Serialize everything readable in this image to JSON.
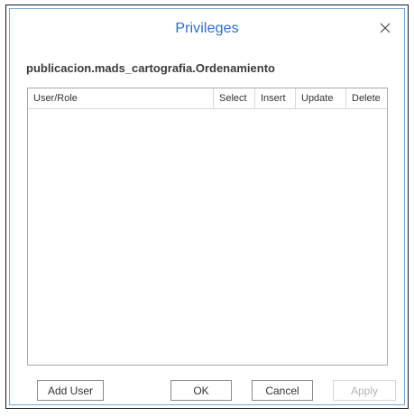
{
  "dialog": {
    "title": "Privileges",
    "close_icon": "close-icon",
    "object_name": "publicacion.mads_cartografia.Ordenamiento"
  },
  "grid": {
    "columns": [
      "User/Role",
      "Select",
      "Insert",
      "Update",
      "Delete"
    ],
    "rows": []
  },
  "buttons": {
    "add_user": "Add User",
    "ok": "OK",
    "cancel": "Cancel",
    "apply": "Apply",
    "apply_enabled": false
  },
  "colors": {
    "title": "#2a6fc9",
    "border": "#7aa6d6"
  }
}
